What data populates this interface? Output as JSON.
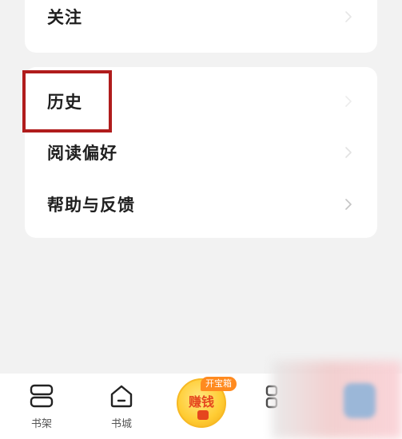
{
  "menu_top": {
    "follow_label": "关注"
  },
  "menu": {
    "items": [
      {
        "label": "历史"
      },
      {
        "label": "阅读偏好"
      },
      {
        "label": "帮助与反馈"
      }
    ]
  },
  "tabbar": {
    "bookshelf_label": "书架",
    "bookstore_label": "书城",
    "earn_label": "赚钱",
    "earn_badge": "开宝箱"
  },
  "colors": {
    "highlight_border": "#b01c1c",
    "earn_badge_bg": "#ff8a1f",
    "earn_text": "#e5461e"
  }
}
